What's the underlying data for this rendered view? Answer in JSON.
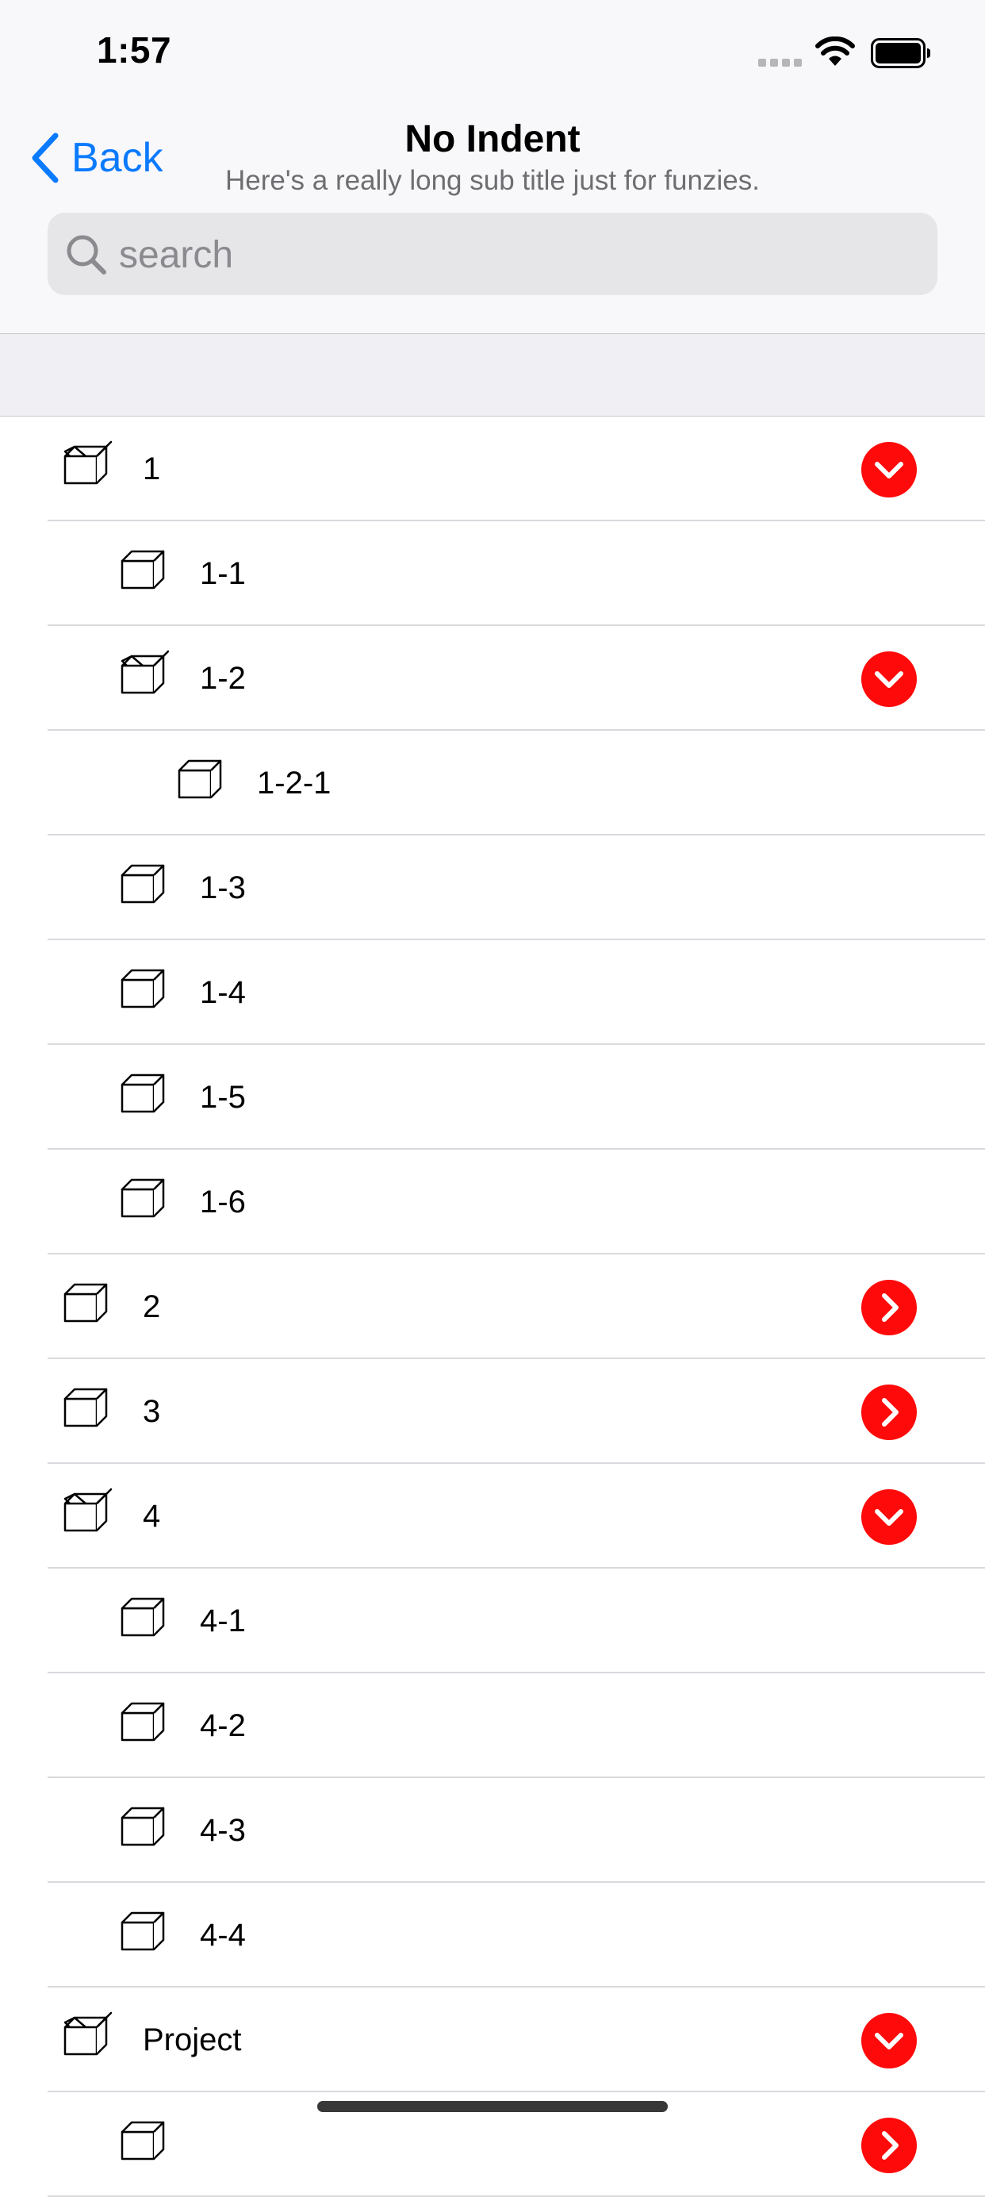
{
  "status": {
    "time": "1:57"
  },
  "nav": {
    "back_label": "Back",
    "title": "No Indent",
    "subtitle": "Here's a really long sub title just for funzies."
  },
  "search": {
    "placeholder": "search"
  },
  "rows": [
    {
      "label": "1",
      "level": 0,
      "open": true,
      "disclosure": "expanded"
    },
    {
      "label": "1-1",
      "level": 1,
      "open": false,
      "disclosure": "none"
    },
    {
      "label": "1-2",
      "level": 1,
      "open": true,
      "disclosure": "expanded"
    },
    {
      "label": "1-2-1",
      "level": 2,
      "open": false,
      "disclosure": "none"
    },
    {
      "label": "1-3",
      "level": 1,
      "open": false,
      "disclosure": "none"
    },
    {
      "label": "1-4",
      "level": 1,
      "open": false,
      "disclosure": "none"
    },
    {
      "label": "1-5",
      "level": 1,
      "open": false,
      "disclosure": "none"
    },
    {
      "label": "1-6",
      "level": 1,
      "open": false,
      "disclosure": "none"
    },
    {
      "label": "2",
      "level": 0,
      "open": false,
      "disclosure": "collapsed"
    },
    {
      "label": "3",
      "level": 0,
      "open": false,
      "disclosure": "collapsed"
    },
    {
      "label": "4",
      "level": 0,
      "open": true,
      "disclosure": "expanded"
    },
    {
      "label": "4-1",
      "level": 1,
      "open": false,
      "disclosure": "none"
    },
    {
      "label": "4-2",
      "level": 1,
      "open": false,
      "disclosure": "none"
    },
    {
      "label": "4-3",
      "level": 1,
      "open": false,
      "disclosure": "none"
    },
    {
      "label": "4-4",
      "level": 1,
      "open": false,
      "disclosure": "none"
    },
    {
      "label": "Project",
      "level": 0,
      "open": true,
      "disclosure": "expanded"
    },
    {
      "label": "",
      "level": 1,
      "open": false,
      "disclosure": "collapsed"
    }
  ],
  "colors": {
    "accent": "#0a7aff",
    "disclosure": "#ff0a0a",
    "separator": "#d9d9de",
    "bar_background": "#f8f8fa",
    "section_background": "#efeff4"
  },
  "icons": {
    "closed_item": "box-icon",
    "open_item": "open-box-icon",
    "expanded": "chevron-down-icon",
    "collapsed": "chevron-right-icon"
  }
}
